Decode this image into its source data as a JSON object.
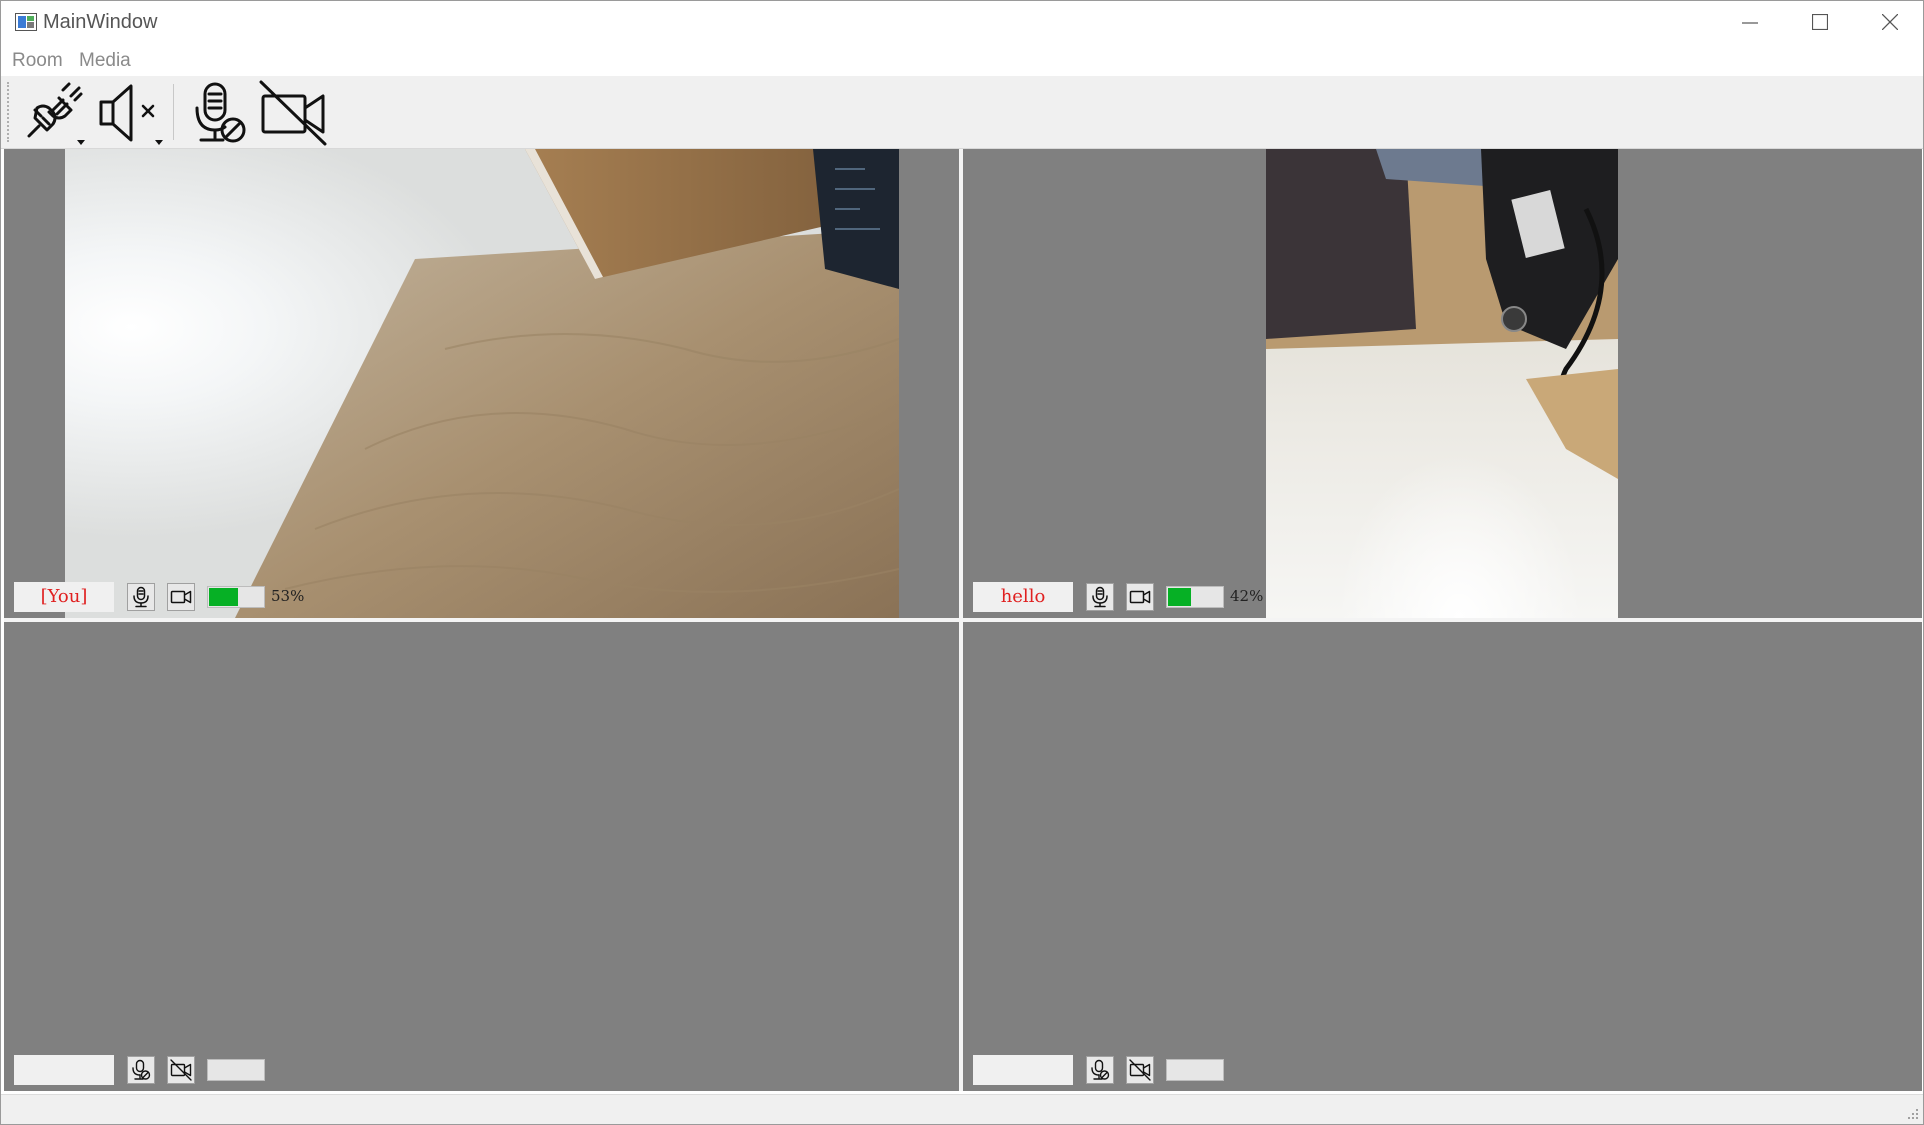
{
  "window": {
    "title": "MainWindow"
  },
  "menu": {
    "items": [
      "Room",
      "Media"
    ]
  },
  "toolbar": {
    "tools": [
      {
        "icon": "plug-disconnect-icon",
        "has_dropdown": true
      },
      {
        "icon": "speaker-muted-icon",
        "has_dropdown": true
      },
      {
        "icon": "microphone-disabled-icon",
        "has_dropdown": false
      },
      {
        "icon": "camera-off-icon",
        "has_dropdown": false
      }
    ]
  },
  "tiles": [
    {
      "name": "[You]",
      "mic_icon": "microphone-icon",
      "camera_icon": "camera-icon",
      "level_percent": 53,
      "level_label": "53%",
      "has_video": true
    },
    {
      "name": "hello",
      "mic_icon": "microphone-icon",
      "camera_icon": "camera-icon",
      "level_percent": 42,
      "level_label": "42%",
      "has_video": true
    },
    {
      "name": "",
      "mic_icon": "microphone-disabled-icon",
      "camera_icon": "camera-off-icon",
      "level_percent": 0,
      "level_label": "",
      "has_video": false
    },
    {
      "name": "",
      "mic_icon": "microphone-disabled-icon",
      "camera_icon": "camera-off-icon",
      "level_percent": 0,
      "level_label": "",
      "has_video": false
    }
  ],
  "colors": {
    "tile_background": "#808080",
    "name_text": "#e02020",
    "level_fill": "#06b025"
  }
}
